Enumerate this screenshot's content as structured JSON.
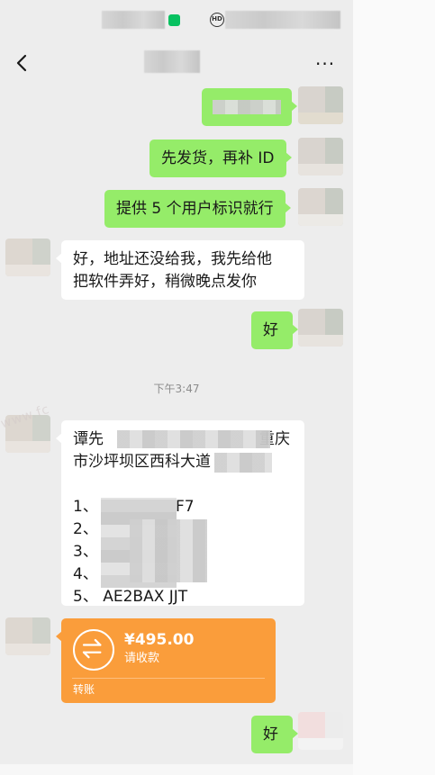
{
  "header": {
    "back_label": "",
    "more_label": "..."
  },
  "messages": [
    {
      "side": "right",
      "text": "先发货，再补 ID"
    },
    {
      "side": "right",
      "text": "提供 5 个用户标识就行"
    },
    {
      "side": "left",
      "lines": [
        "好，地址还没给我，我先给他",
        "把软件弄好，稍微晚点发你"
      ]
    },
    {
      "side": "right",
      "text": "好"
    }
  ],
  "time_label": "下午3:47",
  "address_message": {
    "line1_start": "谭先",
    "line1_end": "重庆",
    "line2": "市沙坪坝区西科大道",
    "items": [
      "1、 ·XDHODAF7",
      "2、 H         HRX",
      "3、 W         E",
      "4、 D         2",
      "5、 AE2BAX  JJT"
    ]
  },
  "transfer": {
    "amount": "¥495.00",
    "status": "请收款",
    "footer": "转账",
    "color": "#fa9d3b"
  },
  "last_message": {
    "side": "right",
    "text": "好"
  },
  "watermark": "www.fc"
}
